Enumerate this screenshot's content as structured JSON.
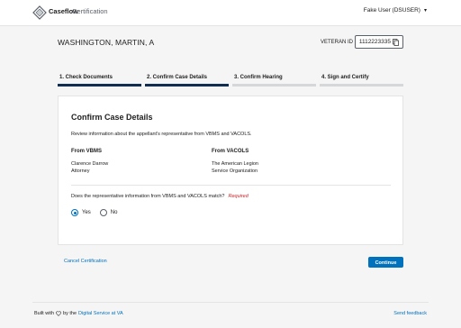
{
  "header": {
    "brand_name": "Caseflow",
    "brand_app": "Certification",
    "user_label": "Fake User (DSUSER)",
    "logo_icon": "caseflow-logo-icon",
    "menu_icon": "chevron-down-icon"
  },
  "case": {
    "veteran_name": "WASHINGTON, MARTIN, A",
    "veteran_id_label": "VETERAN ID",
    "veteran_id": "1112223335",
    "copy_icon": "copy-icon"
  },
  "steps": [
    {
      "label": "1. Check Documents",
      "active": true
    },
    {
      "label": "2. Confirm Case Details",
      "active": true
    },
    {
      "label": "3. Confirm Hearing",
      "active": false
    },
    {
      "label": "4. Sign and Certify",
      "active": false
    }
  ],
  "card": {
    "title": "Confirm Case Details",
    "description": "Review information about the appellant's representative from VBMS and VACOLS.",
    "vbms": {
      "heading": "From VBMS",
      "name": "Clarence Darrow",
      "type": "Attorney"
    },
    "vacols": {
      "heading": "From VACOLS",
      "name": "The American Legion",
      "type": "Service Organization"
    },
    "question": "Does the representative information from VBMS and VACOLS match?",
    "required_label": "Required",
    "options": [
      {
        "label": "Yes",
        "selected": true
      },
      {
        "label": "No",
        "selected": false
      }
    ]
  },
  "actions": {
    "cancel_label": "Cancel Certification",
    "continue_label": "Continue"
  },
  "footer": {
    "built_with": "Built with",
    "by_the": "by the",
    "dsva_link": "Digital Service at VA",
    "feedback_link": "Send feedback",
    "heart_icon": "heart-icon"
  },
  "colors": {
    "accent": "#0071bc",
    "active_step": "#112e51",
    "inactive_step": "#d6d7d9",
    "required": "#cd2026"
  }
}
